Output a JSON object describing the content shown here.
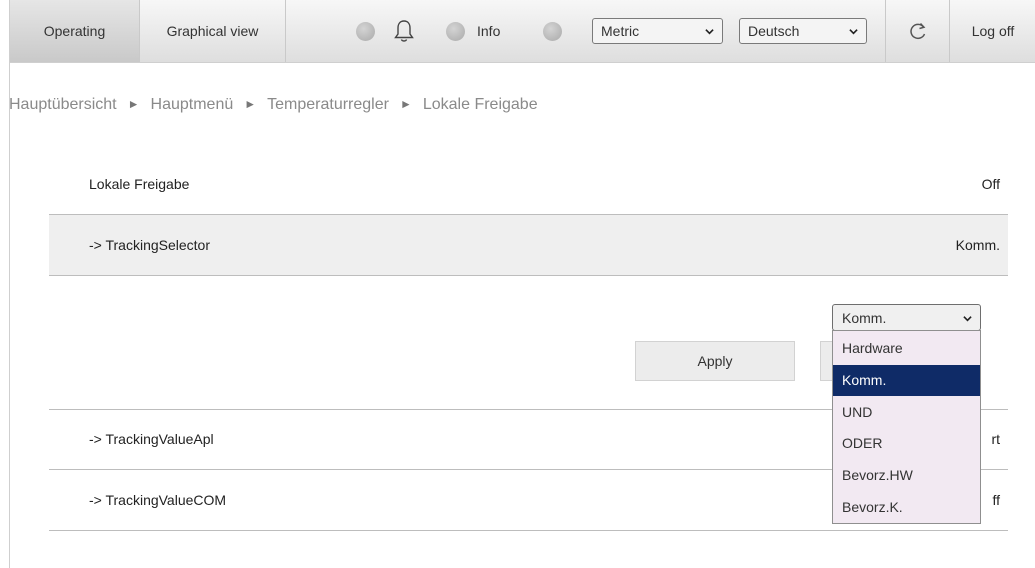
{
  "topbar": {
    "tab_operating": "Operating",
    "tab_graphical": "Graphical view",
    "info_label": "Info",
    "units_select": "Metric",
    "language_select": "Deutsch",
    "logoff": "Log off"
  },
  "breadcrumb": [
    "Hauptübersicht",
    "Hauptmenü",
    "Temperaturregler",
    "Lokale Freigabe"
  ],
  "breadcrumb_separator": "►",
  "rows": {
    "lokale": {
      "label": "Lokale Freigabe",
      "value": "Off"
    },
    "tracking_selector": {
      "label": "-> TrackingSelector",
      "value": "Komm."
    },
    "tracking_value_apl": {
      "label": "-> TrackingValueApl",
      "value": "rt"
    },
    "tracking_value_com": {
      "label": "-> TrackingValueCOM",
      "value": "ff"
    }
  },
  "editor": {
    "apply_label": "Apply",
    "selected": "Komm.",
    "options": [
      "Hardware",
      "Komm.",
      "UND",
      "ODER",
      "Bevorz.HW",
      "Bevorz.K."
    ],
    "selected_index": 1
  },
  "colors": {
    "selected_option_bg": "#0f2b67",
    "dropdown_bg": "#f2e9f2",
    "highlight_row_bg": "#efefef"
  },
  "icons": {
    "bell": "bell-icon",
    "reload": "reload-icon",
    "led": "status-led-icon"
  }
}
